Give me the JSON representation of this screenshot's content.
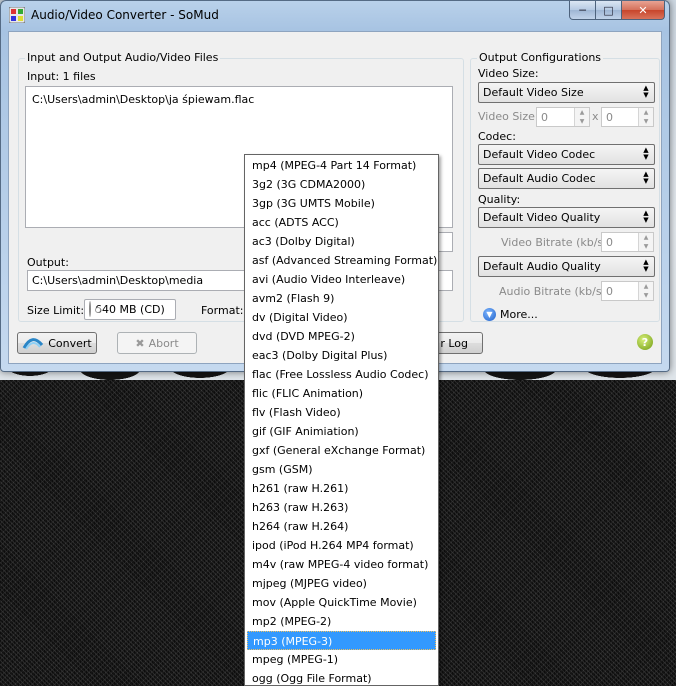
{
  "window": {
    "title": "Audio/Video Converter - SoMud",
    "caption": {
      "minimize": "─",
      "maximize": "□",
      "close": "✕"
    }
  },
  "files": {
    "group_label": "Input and Output Audio/Video Files",
    "input_count": "Input: 1 files",
    "items": [
      "C:\\Users\\admin\\Desktop\\ja śpiewam.flac"
    ],
    "output_label": "Output:",
    "output_path": "C:\\Users\\admin\\Desktop\\media",
    "size_limit_label": "Size Limit:",
    "size_limit_value": "640 MB (CD)",
    "format_label": "Format:"
  },
  "config": {
    "group_label": "Output Configurations",
    "video_size_label": "Video Size:",
    "video_size_value": "Default Video Size",
    "video_size_sub": "Video Size:",
    "video_w": "0",
    "x_sep": "x",
    "video_h": "0",
    "codec_label": "Codec:",
    "video_codec": "Default Video Codec",
    "audio_codec": "Default Audio Codec",
    "quality_label": "Quality:",
    "video_quality": "Default Video Quality",
    "video_bitrate_label": "Video Bitrate (kb/s):",
    "video_bitrate": "0",
    "audio_quality": "Default Audio Quality",
    "audio_bitrate_label": "Audio Bitrate (kb/s):",
    "audio_bitrate": "0",
    "more": "More..."
  },
  "bottom": {
    "convert": "Convert",
    "abort": "Abort",
    "log_partial": "r Log",
    "help": "?"
  },
  "format_dropdown": {
    "selected_index": 25,
    "options": [
      "mp4 (MPEG-4 Part 14 Format)",
      "3g2 (3G CDMA2000)",
      "3gp (3G UMTS Mobile)",
      "acc (ADTS ACC)",
      "ac3 (Dolby Digital)",
      "asf (Advanced Streaming Format)",
      "avi (Audio Video Interleave)",
      "avm2 (Flash 9)",
      "dv (Digital Video)",
      "dvd (DVD MPEG-2)",
      "eac3 (Dolby Digital Plus)",
      "flac (Free Lossless Audio Codec)",
      "flic (FLIC Animation)",
      "flv (Flash Video)",
      "gif (GIF Animiation)",
      "gxf (General eXchange Format)",
      "gsm (GSM)",
      "h261 (raw H.261)",
      "h263 (raw H.263)",
      "h264 (raw H.264)",
      "ipod (iPod H.264 MP4 format)",
      "m4v (raw MPEG-4 video format)",
      "mjpeg (MJPEG video)",
      "mov (Apple QuickTime Movie)",
      "mp2 (MPEG-2)",
      "mp3 (MPEG-3)",
      "mpeg (MPEG-1)",
      "ogg (Ogg File Format)"
    ]
  }
}
